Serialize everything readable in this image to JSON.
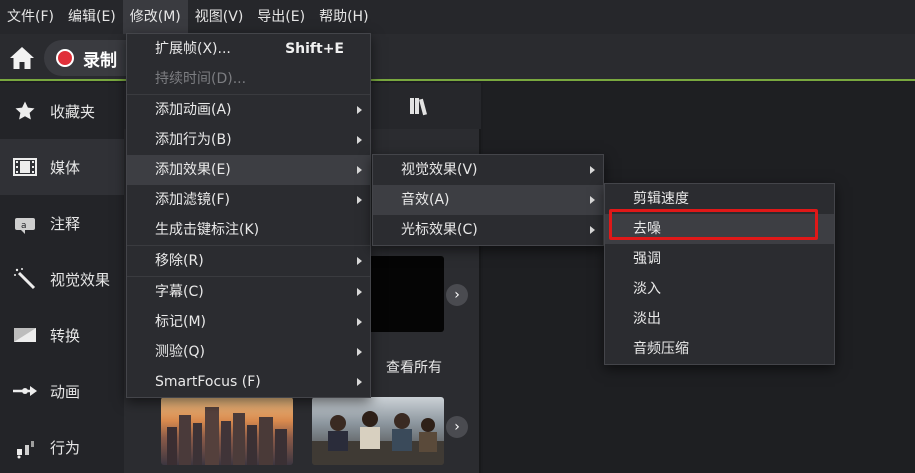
{
  "menubar": {
    "items": [
      {
        "label": "文件(F)"
      },
      {
        "label": "编辑(E)"
      },
      {
        "label": "修改(M)"
      },
      {
        "label": "视图(V)"
      },
      {
        "label": "导出(E)"
      },
      {
        "label": "帮助(H)"
      }
    ]
  },
  "toolbar": {
    "record_label": "录制"
  },
  "sidebar": {
    "items": [
      {
        "label": "收藏夹",
        "icon": "star-icon"
      },
      {
        "label": "媒体",
        "icon": "film-icon"
      },
      {
        "label": "注释",
        "icon": "annotation-icon"
      },
      {
        "label": "视觉效果",
        "icon": "magic-wand-icon"
      },
      {
        "label": "转换",
        "icon": "transition-icon"
      },
      {
        "label": "动画",
        "icon": "animation-arrow-icon"
      },
      {
        "label": "行为",
        "icon": "behavior-icon"
      }
    ]
  },
  "library": {
    "see_all": "查看所有"
  },
  "menu_modify": {
    "items": [
      {
        "label": "扩展帧(X)...",
        "shortcut": "Shift+E"
      },
      {
        "label": "持续时间(D)..."
      },
      {
        "label": "添加动画(A)"
      },
      {
        "label": "添加行为(B)"
      },
      {
        "label": "添加效果(E)"
      },
      {
        "label": "添加滤镜(F)"
      },
      {
        "label": "生成击键标注(K)"
      },
      {
        "label": "移除(R)"
      },
      {
        "label": "字幕(C)"
      },
      {
        "label": "标记(M)"
      },
      {
        "label": "测验(Q)"
      },
      {
        "label": "SmartFocus (F)"
      }
    ]
  },
  "menu_effects": {
    "items": [
      {
        "label": "视觉效果(V)"
      },
      {
        "label": "音效(A)"
      },
      {
        "label": "光标效果(C)"
      }
    ]
  },
  "menu_audio": {
    "items": [
      {
        "label": "剪辑速度"
      },
      {
        "label": "去噪"
      },
      {
        "label": "强调"
      },
      {
        "label": "淡入"
      },
      {
        "label": "淡出"
      },
      {
        "label": "音频压缩"
      }
    ]
  },
  "colors": {
    "accent_green": "#79a83f",
    "highlight_red": "#e01818",
    "record_red": "#e0303a"
  }
}
